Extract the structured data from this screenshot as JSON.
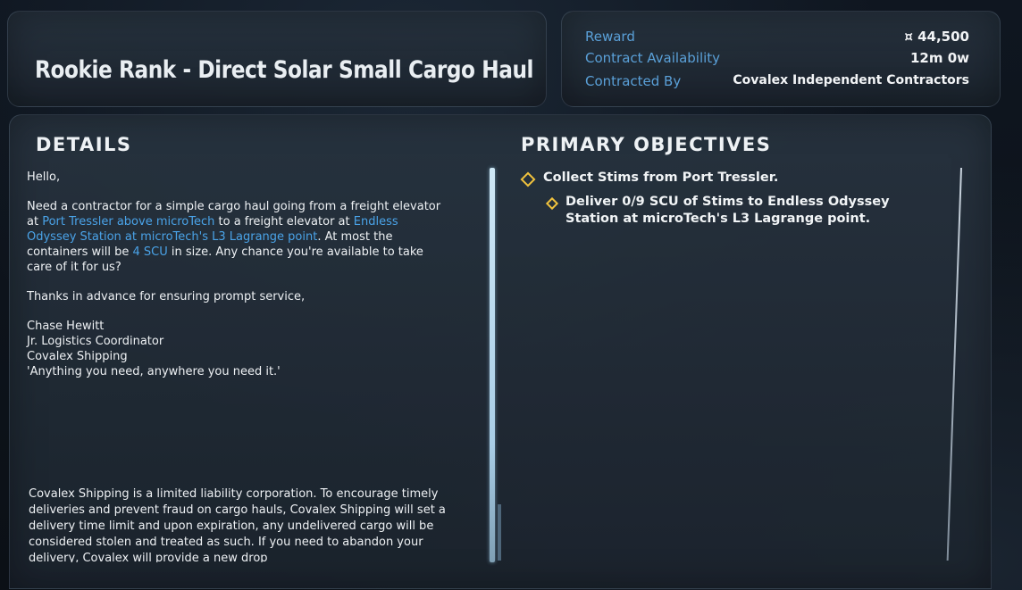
{
  "contract": {
    "title": "Rookie Rank - Direct Solar Small Cargo Haul"
  },
  "info": {
    "reward_label": "Reward",
    "reward_value": "¤ 44,500",
    "availability_label": "Contract Availability",
    "availability_value": "12m 0w",
    "contracted_by_label": "Contracted By",
    "contracted_by_value": "Covalex Independent Contractors"
  },
  "details": {
    "heading": "DETAILS",
    "greeting": "Hello,",
    "para1_a": "Need a contractor for a simple cargo haul going from a freight elevator at ",
    "para1_link1": "Port Tressler above microTech",
    "para1_b": " to a freight elevator at ",
    "para1_link2": "Endless Odyssey Station at microTech's L3 Lagrange point",
    "para1_c": ". At most the containers will be ",
    "para1_link3": "4 SCU",
    "para1_d": " in size. Any chance you're available to take care of it for us?",
    "para2": "Thanks in advance for ensuring prompt service,",
    "signature": {
      "name": "Chase Hewitt",
      "role": "Jr. Logistics Coordinator",
      "company": "Covalex Shipping",
      "motto": "'Anything you need, anywhere you need it.'"
    },
    "legal": "Covalex Shipping is a limited liability corporation. To encourage timely deliveries and prevent fraud on cargo hauls, Covalex Shipping will set a delivery time limit and upon expiration, any undelivered cargo will be considered stolen and treated as such. If you need to abandon your delivery, Covalex will provide a new drop"
  },
  "objectives": {
    "heading": "PRIMARY OBJECTIVES",
    "items": [
      {
        "text": "Collect Stims from Port Tressler."
      },
      {
        "text": "Deliver 0/9 SCU of Stims to Endless Odyssey Station at microTech's L3 Lagrange point."
      }
    ]
  },
  "colors": {
    "accent": "#4aa3e8",
    "label": "#5aa0d8",
    "objective_marker": "#f0c23d"
  }
}
